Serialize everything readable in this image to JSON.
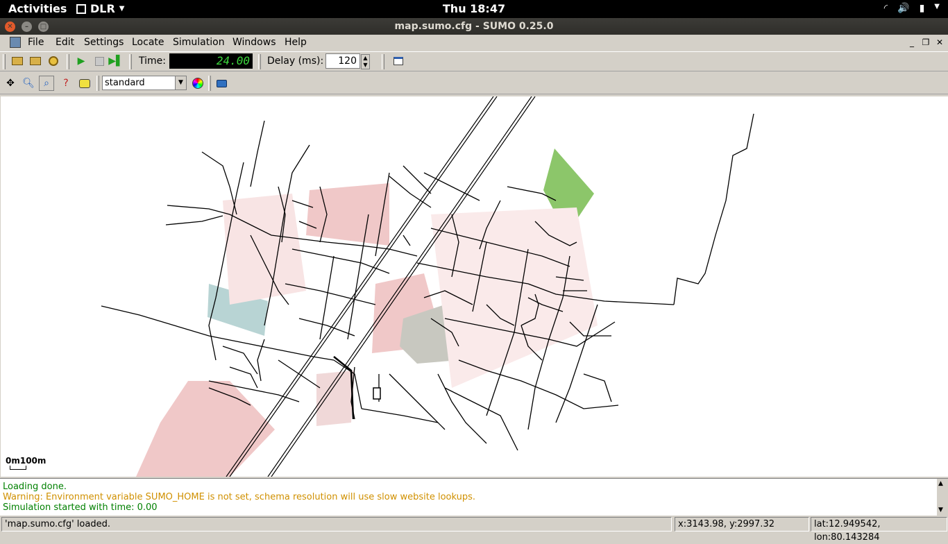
{
  "topbar": {
    "activities": "Activities",
    "app_name": "DLR",
    "clock": "Thu 18:47"
  },
  "window": {
    "title": "map.sumo.cfg - SUMO 0.25.0"
  },
  "menubar": {
    "items": [
      "File",
      "Edit",
      "Settings",
      "Locate",
      "Simulation",
      "Windows",
      "Help"
    ]
  },
  "toolbar": {
    "time_label": "Time:",
    "time_value": "24.00",
    "delay_label": "Delay (ms):",
    "delay_value": "120"
  },
  "view_toolbar": {
    "scheme": "standard"
  },
  "map": {
    "scale_label": "0m100m",
    "colors": {
      "road": "#000000",
      "building": "#f0c8c8",
      "park": "#8cc66a",
      "water": "#b8d4d4",
      "industrial": "#c8c8c0"
    }
  },
  "messages": {
    "line1": "Loading done.",
    "line2": "Warning: Environment variable SUMO_HOME is not set, schema resolution will use slow website lookups.",
    "line3": "Simulation started with time: 0.00",
    "colors": {
      "ok": "#008000",
      "warn": "#d09000"
    }
  },
  "statusbar": {
    "status": "'map.sumo.cfg' loaded.",
    "xy": "x:3143.98, y:2997.32",
    "latlon": "lat:12.949542, lon:80.143284"
  }
}
